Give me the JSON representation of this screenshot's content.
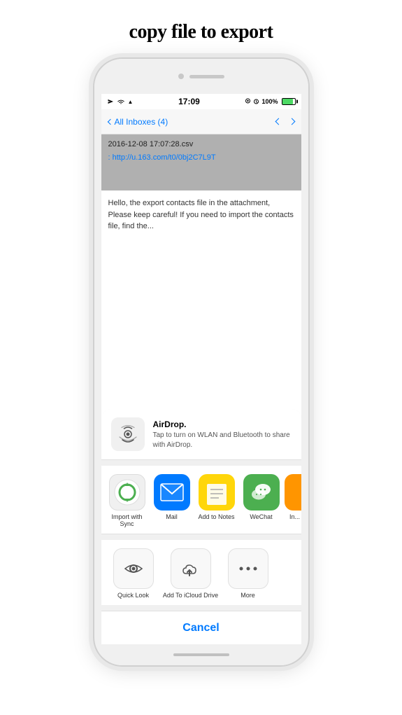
{
  "page": {
    "title": "copy file to export"
  },
  "status_bar": {
    "time": "17:09",
    "battery_percent": "100%",
    "signal_icon": "airplane-icon",
    "wifi_icon": "wifi-icon"
  },
  "nav_bar": {
    "back_label": "All Inboxes (4)"
  },
  "email": {
    "filename": "2016-12-08 17:07:28.csv",
    "link_label": ": http://u.163.com/t0/0bj2C7L9T",
    "body_text": "Hello, the export contacts file in the attachment,  Please keep careful!  If you need to import the contacts file, find the..."
  },
  "share_sheet": {
    "airdrop": {
      "title": "AirDrop.",
      "description": "Tap to turn on WLAN and Bluetooth to share with AirDrop."
    },
    "apps": [
      {
        "id": "import-sync",
        "label": "Import with Sync"
      },
      {
        "id": "mail",
        "label": "Mail"
      },
      {
        "id": "notes",
        "label": "Add to Notes"
      },
      {
        "id": "wechat",
        "label": "WeChat"
      },
      {
        "id": "partial",
        "label": "In..."
      }
    ],
    "actions": [
      {
        "id": "quick-look",
        "label": "Quick Look"
      },
      {
        "id": "icloud-drive",
        "label": "Add To iCloud Drive"
      },
      {
        "id": "more",
        "label": "More"
      }
    ],
    "cancel_label": "Cancel"
  }
}
